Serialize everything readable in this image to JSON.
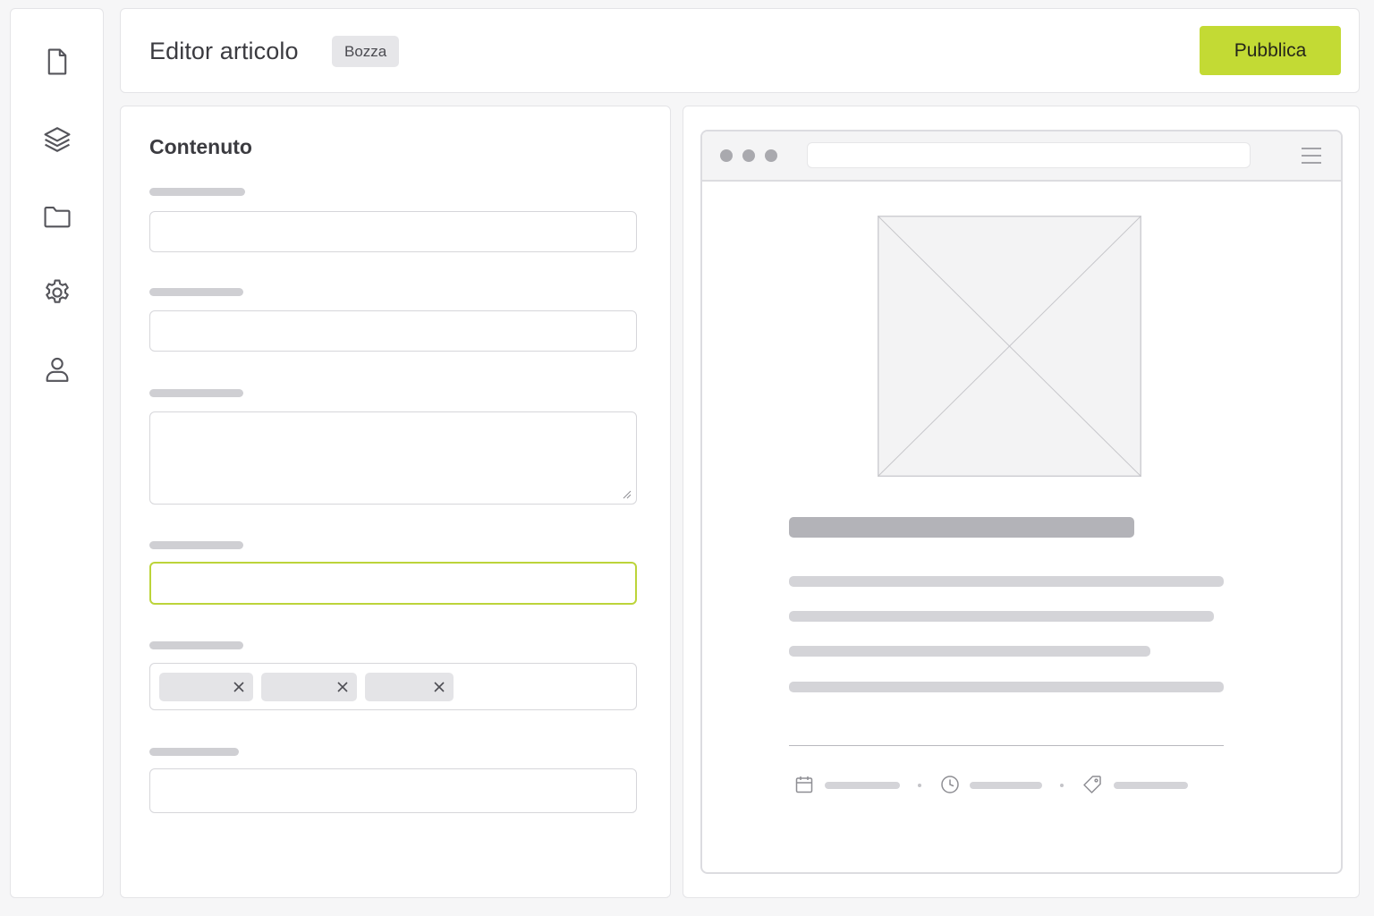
{
  "header": {
    "title": "Editor articolo",
    "status_badge": "Bozza",
    "publish_label": "Pubblica"
  },
  "sidebar": {
    "items": [
      {
        "icon": "file-icon"
      },
      {
        "icon": "layers-icon"
      },
      {
        "icon": "folder-icon"
      },
      {
        "icon": "gear-icon"
      },
      {
        "icon": "user-icon"
      }
    ]
  },
  "form": {
    "title": "Contenuto",
    "fields": [
      {
        "type": "text",
        "value": ""
      },
      {
        "type": "text",
        "value": ""
      },
      {
        "type": "textarea",
        "value": ""
      },
      {
        "type": "text",
        "value": "",
        "focused": true
      },
      {
        "type": "tags",
        "tag_count": 3
      },
      {
        "type": "text",
        "value": ""
      }
    ]
  },
  "preview": {
    "image": "image-placeholder",
    "meta_icons": [
      "calendar-icon",
      "clock-icon",
      "tag-icon"
    ]
  },
  "colors": {
    "accent": "#c3da34",
    "focus_border": "#bcd43a",
    "skeleton_dark": "#b3b3b8",
    "skeleton_light": "#d4d4d8",
    "background": "#f6f6f7"
  }
}
